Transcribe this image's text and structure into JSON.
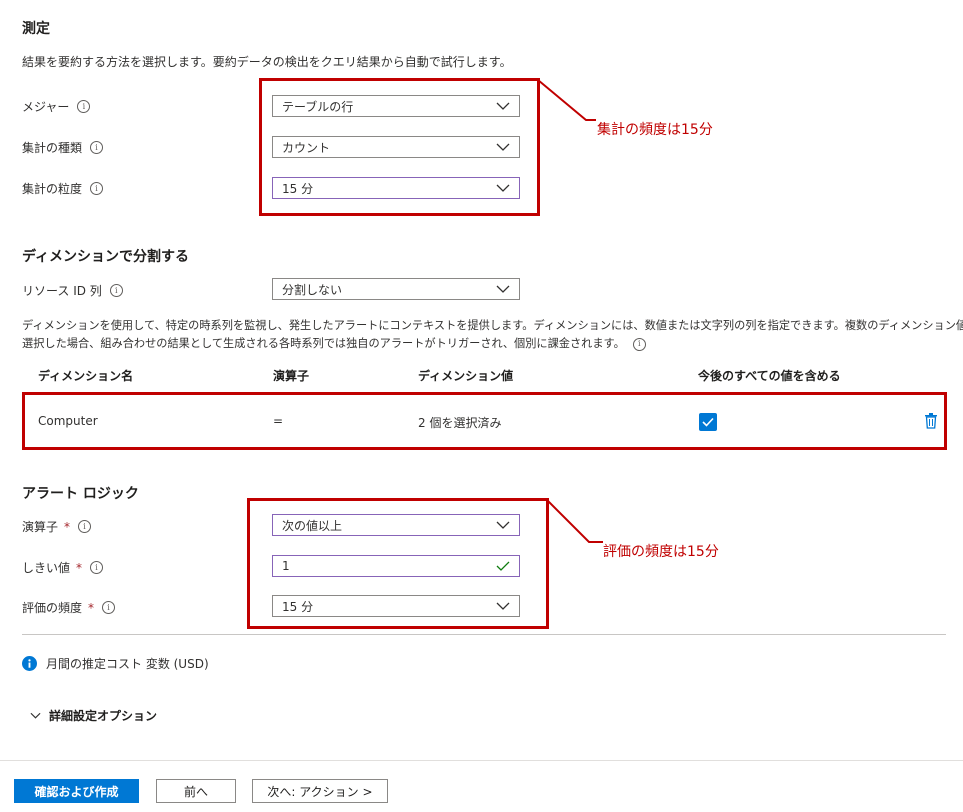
{
  "measurement": {
    "title": "測定",
    "description": "結果を要約する方法を選択します。要約データの検出をクエリ結果から自動で試行します。",
    "measure": {
      "label": "メジャー",
      "value": "テーブルの行"
    },
    "aggregation_type": {
      "label": "集計の種類",
      "value": "カウント"
    },
    "aggregation_granularity": {
      "label": "集計の粒度",
      "value": "15 分"
    }
  },
  "split_by_dimensions": {
    "title": "ディメンションで分割する",
    "resource_id_column": {
      "label": "リソース ID 列",
      "value": "分割しない"
    },
    "description_line1": "ディメンションを使用して、特定の時系列を監視し、発生したアラートにコンテキストを提供します。ディメンションには、数値または文字列の列を指定できます。複数のディメンション値を",
    "description_line2": "選択した場合、組み合わせの結果として生成される各時系列では独自のアラートがトリガーされ、個別に課金されます。",
    "table": {
      "headers": [
        "ディメンション名",
        "演算子",
        "ディメンション値",
        "今後のすべての値を含める"
      ],
      "rows": [
        {
          "name": "Computer",
          "operator": "=",
          "values": "2 個を選択済み",
          "include_future": true
        }
      ]
    }
  },
  "alert_logic": {
    "title": "アラート ロジック",
    "operator": {
      "label": "演算子",
      "value": "次の値以上"
    },
    "threshold": {
      "label": "しきい値",
      "value": "1"
    },
    "frequency": {
      "label": "評価の頻度",
      "value": "15 分"
    },
    "required_mark": "*"
  },
  "cost": {
    "text": "月間の推定コスト 変数 (USD)"
  },
  "advanced": {
    "label": "詳細設定オプション"
  },
  "annotations": {
    "granularity_note": "集計の頻度は15分",
    "frequency_note": "評価の頻度は15分",
    "color": "#c00000"
  },
  "footer": {
    "review_create": "確認および作成",
    "previous": "前へ",
    "next": "次へ: アクション >"
  },
  "colors": {
    "accent": "#0078d4",
    "focus_border": "#8764b8",
    "valid": "#107c10"
  }
}
